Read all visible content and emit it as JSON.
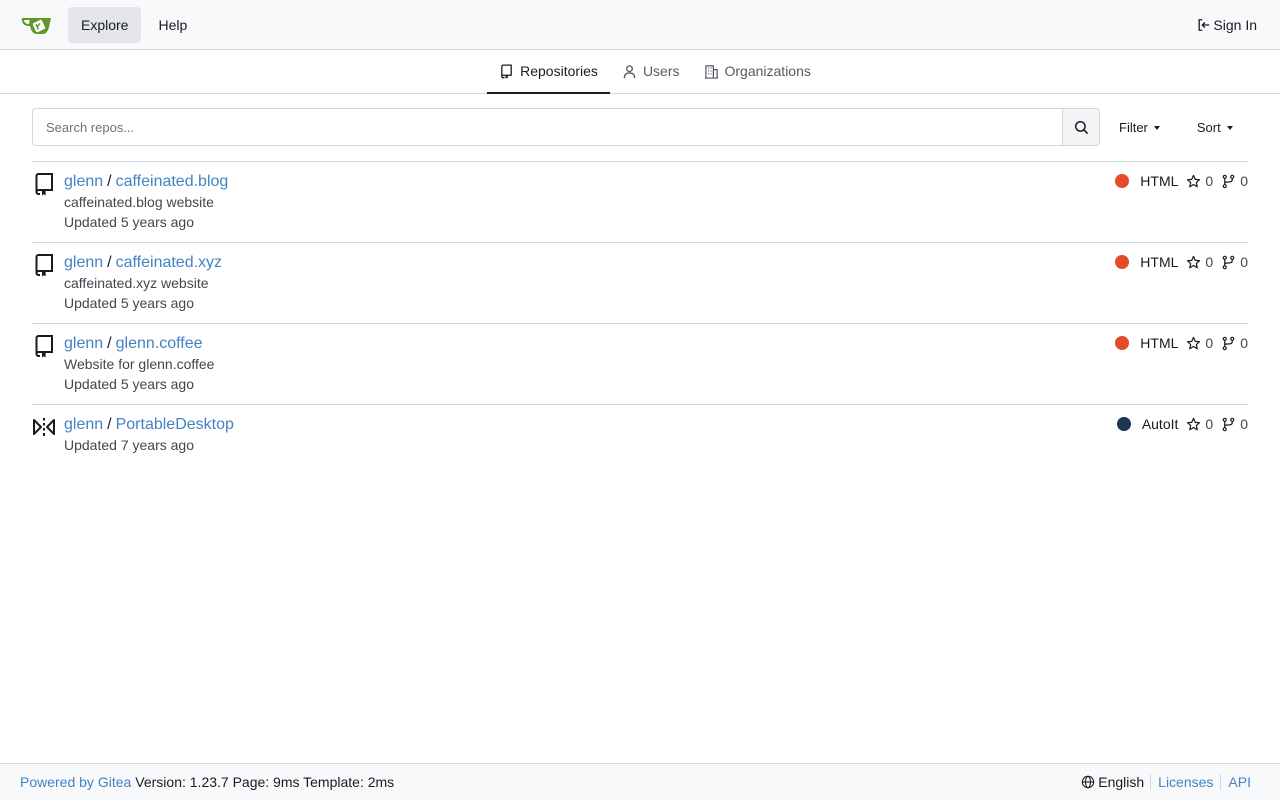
{
  "nav": {
    "explore": "Explore",
    "help": "Help",
    "sign_in": "Sign In"
  },
  "tabs": {
    "repositories": "Repositories",
    "users": "Users",
    "organizations": "Organizations"
  },
  "search": {
    "placeholder": "Search repos...",
    "filter_label": "Filter",
    "sort_label": "Sort"
  },
  "repos": [
    {
      "owner": "glenn",
      "name": "caffeinated.blog",
      "description": "caffeinated.blog website",
      "updated": "Updated 5 years ago",
      "language": "HTML",
      "language_color": "#e34c26",
      "stars": "0",
      "forks": "0",
      "icon": "repo-icon"
    },
    {
      "owner": "glenn",
      "name": "caffeinated.xyz",
      "description": "caffeinated.xyz website",
      "updated": "Updated 5 years ago",
      "language": "HTML",
      "language_color": "#e34c26",
      "stars": "0",
      "forks": "0",
      "icon": "repo-icon"
    },
    {
      "owner": "glenn",
      "name": "glenn.coffee",
      "description": "Website for glenn.coffee",
      "updated": "Updated 5 years ago",
      "language": "HTML",
      "language_color": "#e34c26",
      "stars": "0",
      "forks": "0",
      "icon": "repo-icon"
    },
    {
      "owner": "glenn",
      "name": "PortableDesktop",
      "description": "",
      "updated": "Updated 7 years ago",
      "language": "AutoIt",
      "language_color": "#1c3552",
      "stars": "0",
      "forks": "0",
      "icon": "mirror-icon"
    }
  ],
  "footer": {
    "powered_by": "Powered by Gitea",
    "version_info": "Version: 1.23.7 Page: 9ms Template: 2ms",
    "language": "English",
    "licenses": "Licenses",
    "api": "API"
  },
  "colors": {
    "link": "#4183c4",
    "logo_green": "#609926"
  }
}
